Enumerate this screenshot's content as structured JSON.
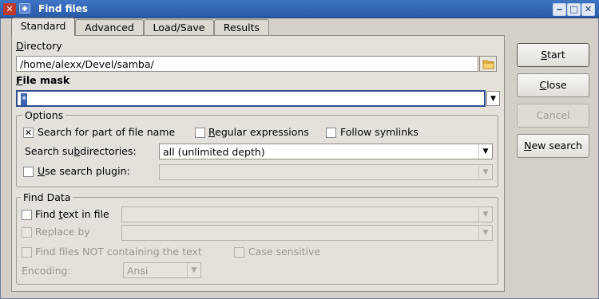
{
  "window": {
    "title": "Find files",
    "app_icon": "dc-logo-icon",
    "menu_icon": "window-menu-icon"
  },
  "titlebar_buttons": {
    "minimize": "‒",
    "maximize": "□",
    "close": "✕"
  },
  "tabs": [
    {
      "label": "Standard",
      "active": true
    },
    {
      "label": "Advanced",
      "active": false
    },
    {
      "label": "Load/Save",
      "active": false
    },
    {
      "label": "Results",
      "active": false
    }
  ],
  "directory": {
    "label_first": "D",
    "label_rest": "irectory",
    "value": "/home/alexx/Devel/samba/",
    "browse_icon": "folder-icon"
  },
  "file_mask": {
    "label_first": "F",
    "label_rest": "ile mask",
    "value": "*"
  },
  "options": {
    "legend": "Options",
    "search_part": {
      "label": "Search for part of file name",
      "checked": true
    },
    "regex": {
      "label_first": "R",
      "label_rest": "egular expressions",
      "checked": false
    },
    "symlinks": {
      "label": "Follow symlinks",
      "checked": false
    },
    "subdirs": {
      "label_pre": "Search su",
      "label_u": "b",
      "label_post": "directories:",
      "value": "all (unlimited depth)"
    },
    "plugin": {
      "label_first": "U",
      "label_rest": "se search plugin:",
      "checked": false,
      "value": ""
    }
  },
  "find_data": {
    "legend": "Find Data",
    "find_text": {
      "label_pre": "Find ",
      "label_u": "t",
      "label_post": "ext in file",
      "checked": false,
      "value": ""
    },
    "replace": {
      "label": "Replace by",
      "checked": false,
      "value": ""
    },
    "not_containing": {
      "label": "Find files NOT containing the text",
      "checked": false
    },
    "case": {
      "label": "Case sensitive",
      "checked": false
    },
    "encoding": {
      "label": "Encoding:",
      "value": "Ansi"
    }
  },
  "buttons": {
    "start": {
      "label_first": "S",
      "label_rest": "tart"
    },
    "close": {
      "label_first": "C",
      "label_rest": "lose"
    },
    "cancel": {
      "label": "Cancel"
    },
    "new_search": {
      "label_first": "N",
      "label_rest": "ew search"
    }
  }
}
